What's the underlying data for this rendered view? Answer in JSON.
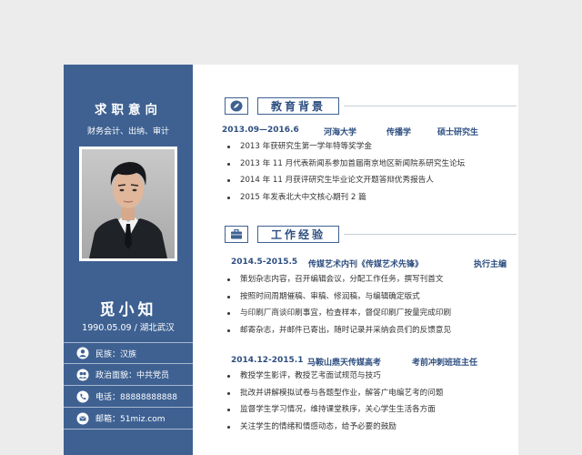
{
  "sidebar": {
    "title": "求职意向",
    "subtitle": "财务会计、出纳、审计",
    "name": "觅小知",
    "birth_place": "1990.05.09  /  湖北武汉",
    "info": [
      {
        "icon": "user-icon",
        "text": "民族：汉族"
      },
      {
        "icon": "group-icon",
        "text": "政治面貌：中共党员"
      },
      {
        "icon": "phone-icon",
        "text": "电话：88888888888"
      },
      {
        "icon": "mail-icon",
        "text": "邮箱：51miz.com"
      }
    ]
  },
  "education": {
    "title": "教育背景",
    "icon": "leaf-icon",
    "date": "2013.09—2016.6",
    "school": "河海大学",
    "major": "传播学",
    "degree": "硕士研究生",
    "items": [
      "2013 年获研究生第一学年特等奖学金",
      "2013 年 11 月代表新闻系参加首届南京地区新闻院系研究生论坛",
      "2014 年 11 月获评研究生毕业论文开题答辩优秀报告人",
      "2015 年发表北大中文核心期刊 2 篇"
    ]
  },
  "work": {
    "title": "工作经验",
    "icon": "briefcase-icon",
    "jobs": [
      {
        "date": "2014.5-2015.5",
        "company": "传媒艺术内刊《传媒艺术先锋》",
        "position": "执行主编",
        "items": [
          "策划杂志内容，召开编辑会议，分配工作任务，撰写刊首文",
          "按照时间周期催稿、审稿、修润稿，与编辑确定版式",
          "与印刷厂商谈印刷事宜，检查样本，督促印刷厂按量完成印刷",
          "邮寄杂志，并邮件已寄出，随时记录并采纳会员们的反馈意见"
        ]
      },
      {
        "date": "2014.12-2015.1",
        "company": "马鞍山鼎天传媒高考",
        "position": "考前冲刺班班主任",
        "items": [
          "教授学生影评，教授艺考面试规范与技巧",
          "批改并讲解模拟试卷与各题型作业，解答广电编艺考的问题",
          "监督学生学习情况，维持课堂秩序，关心学生生活各方面",
          "关注学生的情绪和情感动态，给予必要的鼓励"
        ]
      }
    ]
  },
  "colors": {
    "accent": "#3e6192",
    "heading_text": "#2d4e80",
    "background": "#ececec"
  }
}
